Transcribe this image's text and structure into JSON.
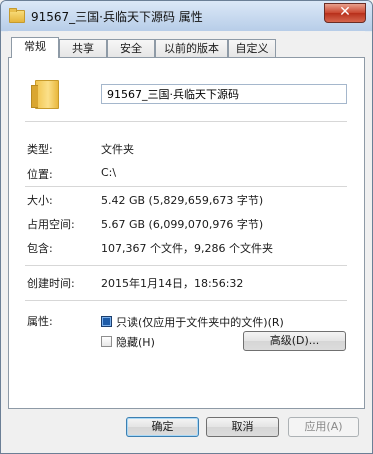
{
  "window": {
    "title": "91567_三国·兵临天下源码 属性",
    "close_label": "✕"
  },
  "tabs": [
    {
      "label": "常规",
      "active": true
    },
    {
      "label": "共享",
      "active": false
    },
    {
      "label": "安全",
      "active": false
    },
    {
      "label": "以前的版本",
      "active": false
    },
    {
      "label": "自定义",
      "active": false
    }
  ],
  "general": {
    "folder_name": "91567_三国·兵临天下源码",
    "type_label": "类型:",
    "type_value": "文件夹",
    "location_label": "位置:",
    "location_value": "C:\\",
    "size_label": "大小:",
    "size_value": "5.42 GB (5,829,659,673 字节)",
    "disk_size_label": "占用空间:",
    "disk_size_value": "5.67 GB (6,099,070,976 字节)",
    "contains_label": "包含:",
    "contains_value": "107,367 个文件，9,286 个文件夹",
    "created_label": "创建时间:",
    "created_value": "2015年1月14日，18:56:32",
    "attributes_label": "属性:",
    "readonly_label": "只读(仅应用于文件夹中的文件)(R)",
    "readonly_state": "indeterminate",
    "hidden_label": "隐藏(H)",
    "hidden_checked": false,
    "advanced_button": "高级(D)..."
  },
  "footer": {
    "ok": "确定",
    "cancel": "取消",
    "apply": "应用(A)"
  },
  "colors": {
    "title_gradient_top": "#dbe8f7",
    "close_button": "#c9452e",
    "selection_blue": "#1e5ca8"
  }
}
